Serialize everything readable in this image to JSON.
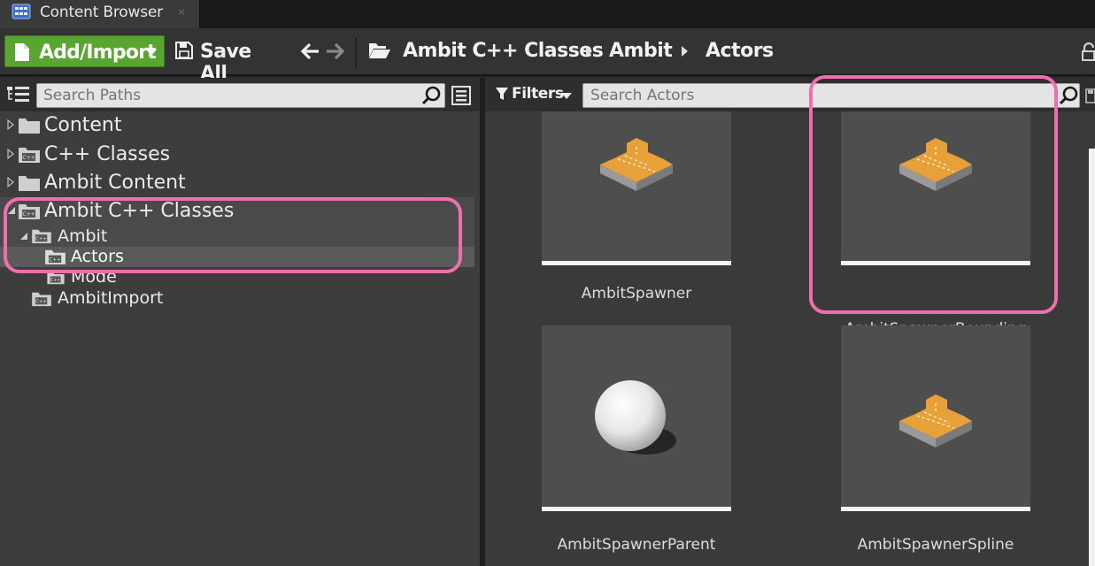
{
  "window": {
    "tab_title": "Content Browser",
    "close_glyph": "×"
  },
  "toolbar": {
    "add_import_label": "Add/Import",
    "save_all_label": "Save All",
    "breadcrumb": [
      "Ambit C++ Classes",
      "Ambit",
      "Actors"
    ]
  },
  "sources": {
    "search_placeholder": "Search Paths",
    "tree": [
      {
        "label": "Content",
        "kind": "folder",
        "expander": "collapsed"
      },
      {
        "label": "C++ Classes",
        "kind": "cpp-folder",
        "expander": "collapsed"
      },
      {
        "label": "Ambit Content",
        "kind": "folder",
        "expander": "collapsed"
      },
      {
        "label": "Ambit C++ Classes",
        "kind": "cpp-folder",
        "expander": "expanded"
      },
      {
        "label": "Ambit",
        "kind": "cpp-folder",
        "expander": "expanded"
      },
      {
        "label": "Actors",
        "kind": "cpp-folder",
        "expander": "none",
        "selected": true
      },
      {
        "label": "Mode",
        "kind": "cpp-folder",
        "expander": "none"
      },
      {
        "label": "AmbitImport",
        "kind": "cpp-folder",
        "expander": "none"
      }
    ]
  },
  "assets": {
    "filters_label": "Filters",
    "search_placeholder": "Search Actors",
    "items": [
      {
        "name": "AmbitSpawner",
        "thumbnail": "spawner-cross-icon"
      },
      {
        "name": "AmbitSpawnerBounding",
        "thumbnail": "spawner-cross-icon"
      },
      {
        "name": "AmbitSpawnerParent",
        "thumbnail": "sphere-icon"
      },
      {
        "name": "AmbitSpawnerSpline",
        "thumbnail": "spawner-cross-icon"
      }
    ]
  },
  "colors": {
    "accent_green": "#58a52f",
    "annotation_pink": "#ef6fae",
    "spawner_orange": "#e8a038"
  }
}
